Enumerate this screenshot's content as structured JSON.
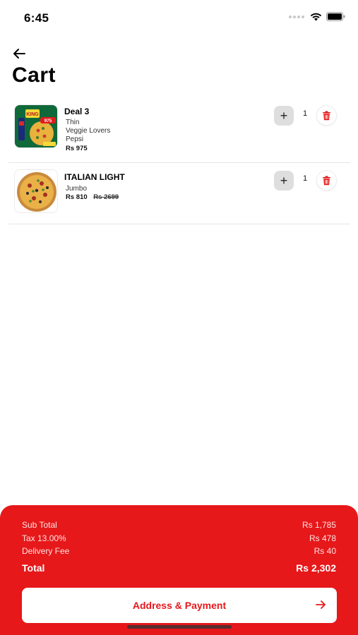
{
  "status_bar": {
    "time": "6:45"
  },
  "header": {
    "title": "Cart"
  },
  "items": [
    {
      "name": "Deal 3",
      "details": [
        "Thin",
        "Veggie Lovers",
        "Pepsi"
      ],
      "price": "Rs 975",
      "quantity": "1",
      "thumb_text": "975"
    },
    {
      "name": "ITALIAN LIGHT",
      "details": [
        "Jumbo"
      ],
      "price": "Rs 810",
      "old_price": "Rs 2699",
      "quantity": "1"
    }
  ],
  "summary": {
    "subtotal_label": "Sub Total",
    "subtotal_value": "Rs 1,785",
    "tax_label": "Tax 13.00%",
    "tax_value": "Rs 478",
    "delivery_label": "Delivery Fee",
    "delivery_value": "Rs 40",
    "total_label": "Total",
    "total_value": "Rs 2,302"
  },
  "cta": {
    "label": "Address & Payment"
  },
  "colors": {
    "accent": "#e6181a",
    "panel_text": "#ffe3e3",
    "white": "#ffffff"
  }
}
